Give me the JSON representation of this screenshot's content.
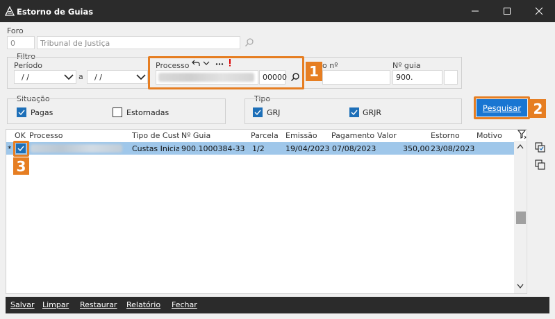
{
  "window": {
    "title": "Estorno de Guias"
  },
  "foro": {
    "label": "Foro",
    "code": "0",
    "name_placeholder": "Tribunal de Justiça"
  },
  "filtro": {
    "label": "Filtro",
    "periodo_label": "Período",
    "date_from": "/ /",
    "separator": "a",
    "date_to": "/ /",
    "processo_label": "Processo",
    "processo_suffix": "00000",
    "hidden_label_suffix": "o nº",
    "guia_label": "Nº guia",
    "guia_value": "900."
  },
  "situacao": {
    "label": "Situação",
    "pagas": "Pagas",
    "estornadas": "Estornadas"
  },
  "tipo": {
    "label": "Tipo",
    "grj": "GRJ",
    "grjr": "GRJR"
  },
  "actions": {
    "pesquisar": "Pesquisar"
  },
  "badges": {
    "one": "1",
    "two": "2",
    "three": "3"
  },
  "table": {
    "columns": [
      "OK",
      "Processo",
      "Tipo de Custa",
      "Nº Guia",
      "Parcela",
      "Emissão",
      "Pagamento",
      "Valor",
      "Estorno",
      "Motivo"
    ],
    "rows": [
      {
        "marker": "*",
        "processo": "",
        "tipo_custa": "Custas Iniciai:",
        "guia": "900.1000384-33",
        "parcela": "1/2",
        "emissao": "19/04/2023",
        "pagamento": "07/08/2023",
        "valor": "350,00",
        "estorno": "23/08/2023",
        "motivo": ""
      }
    ]
  },
  "bottom": {
    "salvar": "Salvar",
    "limpar": "Limpar",
    "restaurar": "Restaurar",
    "relatorio": "Relatório",
    "fechar": "Fechar"
  },
  "colors": {
    "accent": "#1976d2",
    "highlight": "#e67e22",
    "selected_row": "#9fc7ea",
    "titlebar": "#2b2b2b"
  },
  "icons": [
    "app-icon",
    "minimize-icon",
    "maximize-icon",
    "close-icon",
    "search-icon",
    "undo-icon",
    "chevron-down-icon",
    "more-icon",
    "alert-icon",
    "filter-icon",
    "copy-icon",
    "duplicate-icon"
  ]
}
